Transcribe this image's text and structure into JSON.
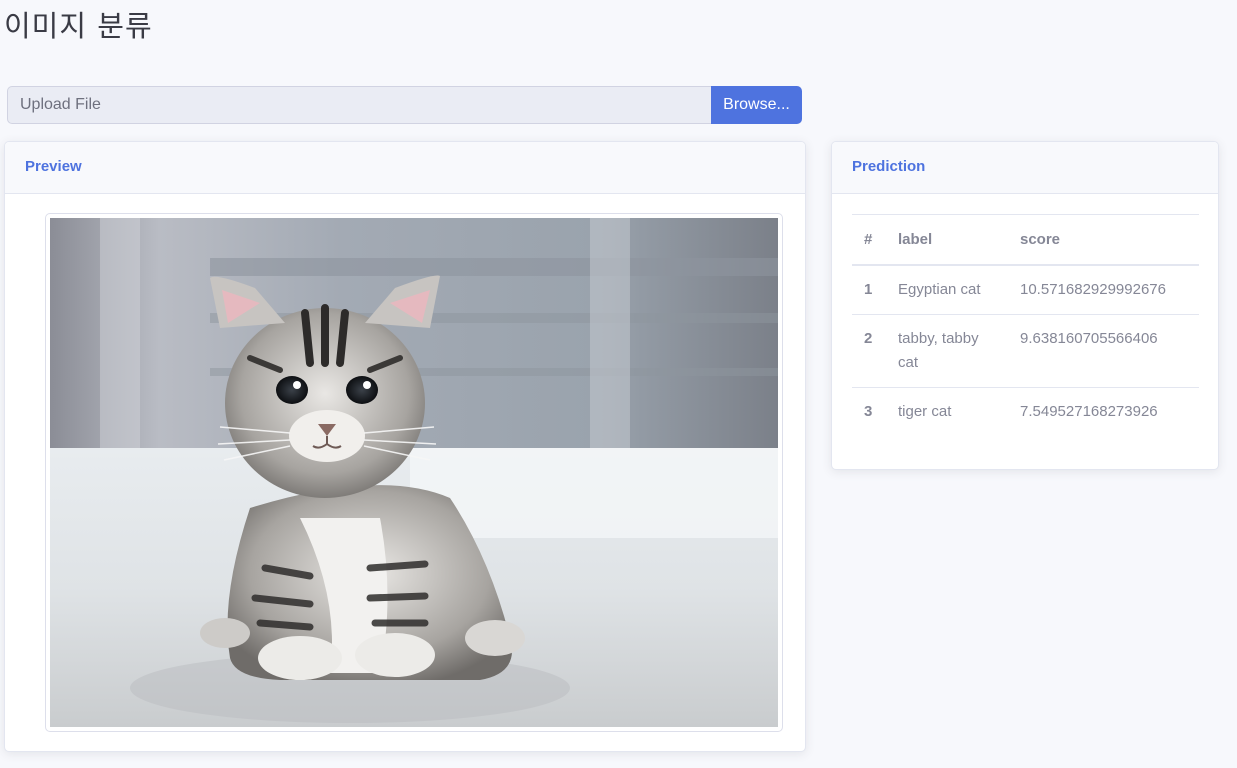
{
  "page": {
    "title": "이미지 분류"
  },
  "upload": {
    "placeholder": "Upload File",
    "browse_label": "Browse..."
  },
  "preview": {
    "header": "Preview"
  },
  "prediction": {
    "header": "Prediction",
    "columns": [
      "#",
      "label",
      "score"
    ],
    "rows": [
      {
        "rank": "1",
        "label": "Egyptian cat",
        "score": "10.571682929992676"
      },
      {
        "rank": "2",
        "label": "tabby, tabby cat",
        "score": "9.638160705566406"
      },
      {
        "rank": "3",
        "label": "tiger cat",
        "score": "7.549527168273926"
      }
    ]
  },
  "colors": {
    "accent": "#4e73df",
    "background": "#f7f8fc",
    "text_muted": "#858796"
  }
}
